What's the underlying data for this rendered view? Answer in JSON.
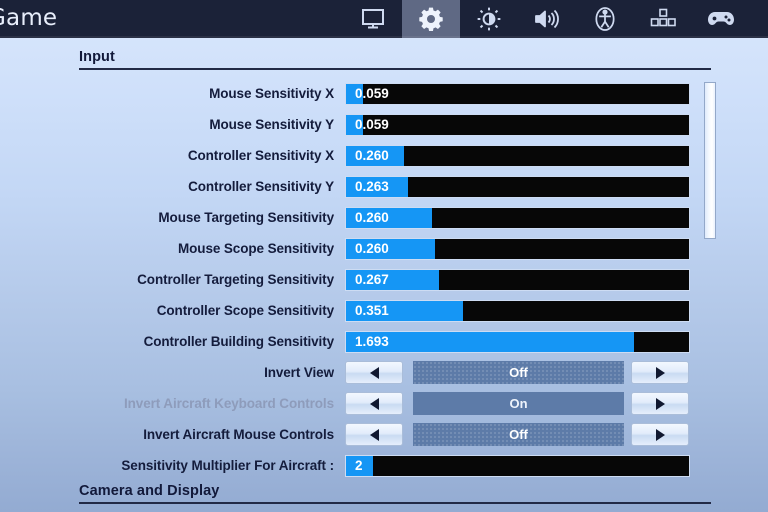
{
  "topbar": {
    "game_title": "Game",
    "tabs": [
      {
        "name": "video",
        "icon": "monitor-icon",
        "active": false
      },
      {
        "name": "game",
        "icon": "gear-icon",
        "active": true
      },
      {
        "name": "brightness",
        "icon": "brightness-icon",
        "active": false
      },
      {
        "name": "audio",
        "icon": "speaker-icon",
        "active": false
      },
      {
        "name": "accessibility",
        "icon": "accessibility-icon",
        "active": false
      },
      {
        "name": "keyboard",
        "icon": "keybinds-icon",
        "active": false
      },
      {
        "name": "controller",
        "icon": "gamepad-icon",
        "active": false
      }
    ]
  },
  "sections": {
    "input_header": "Input",
    "camera_header": "Camera and Display"
  },
  "rows": [
    {
      "label": "Mouse Sensitivity X",
      "type": "slider",
      "value": "0.059",
      "fill_pct": 5,
      "disabled": false
    },
    {
      "label": "Mouse Sensitivity Y",
      "type": "slider",
      "value": "0.059",
      "fill_pct": 5,
      "disabled": false
    },
    {
      "label": "Controller Sensitivity X",
      "type": "slider",
      "value": "0.260",
      "fill_pct": 17,
      "disabled": false
    },
    {
      "label": "Controller Sensitivity Y",
      "type": "slider",
      "value": "0.263",
      "fill_pct": 18,
      "disabled": false
    },
    {
      "label": "Mouse Targeting Sensitivity",
      "type": "slider",
      "value": "0.260",
      "fill_pct": 25,
      "disabled": false
    },
    {
      "label": "Mouse Scope Sensitivity",
      "type": "slider",
      "value": "0.260",
      "fill_pct": 26,
      "disabled": false
    },
    {
      "label": "Controller Targeting Sensitivity",
      "type": "slider",
      "value": "0.267",
      "fill_pct": 27,
      "disabled": false
    },
    {
      "label": "Controller Scope Sensitivity",
      "type": "slider",
      "value": "0.351",
      "fill_pct": 34,
      "disabled": false
    },
    {
      "label": "Controller Building Sensitivity",
      "type": "slider",
      "value": "1.693",
      "fill_pct": 84,
      "disabled": false
    },
    {
      "label": "Invert View",
      "type": "toggle",
      "value": "Off",
      "disabled": false
    },
    {
      "label": "Invert Aircraft Keyboard Controls",
      "type": "toggle",
      "value": "On",
      "disabled": true
    },
    {
      "label": "Invert Aircraft Mouse Controls",
      "type": "toggle",
      "value": "Off",
      "disabled": false
    },
    {
      "label": "Sensitivity Multiplier For Aircraft :",
      "type": "slider",
      "value": "2",
      "fill_pct": 8,
      "disabled": false
    }
  ],
  "scrollbar": {
    "thumb_top_pct": 1,
    "thumb_height_pct": 37
  },
  "colors": {
    "accent_blue": "#1596f5",
    "topbar": "#1b2238",
    "track_black": "#070707",
    "toggle_value_bg": "#5d7ba8",
    "label_text": "#141c3c",
    "label_disabled": "#8e9cbb"
  }
}
